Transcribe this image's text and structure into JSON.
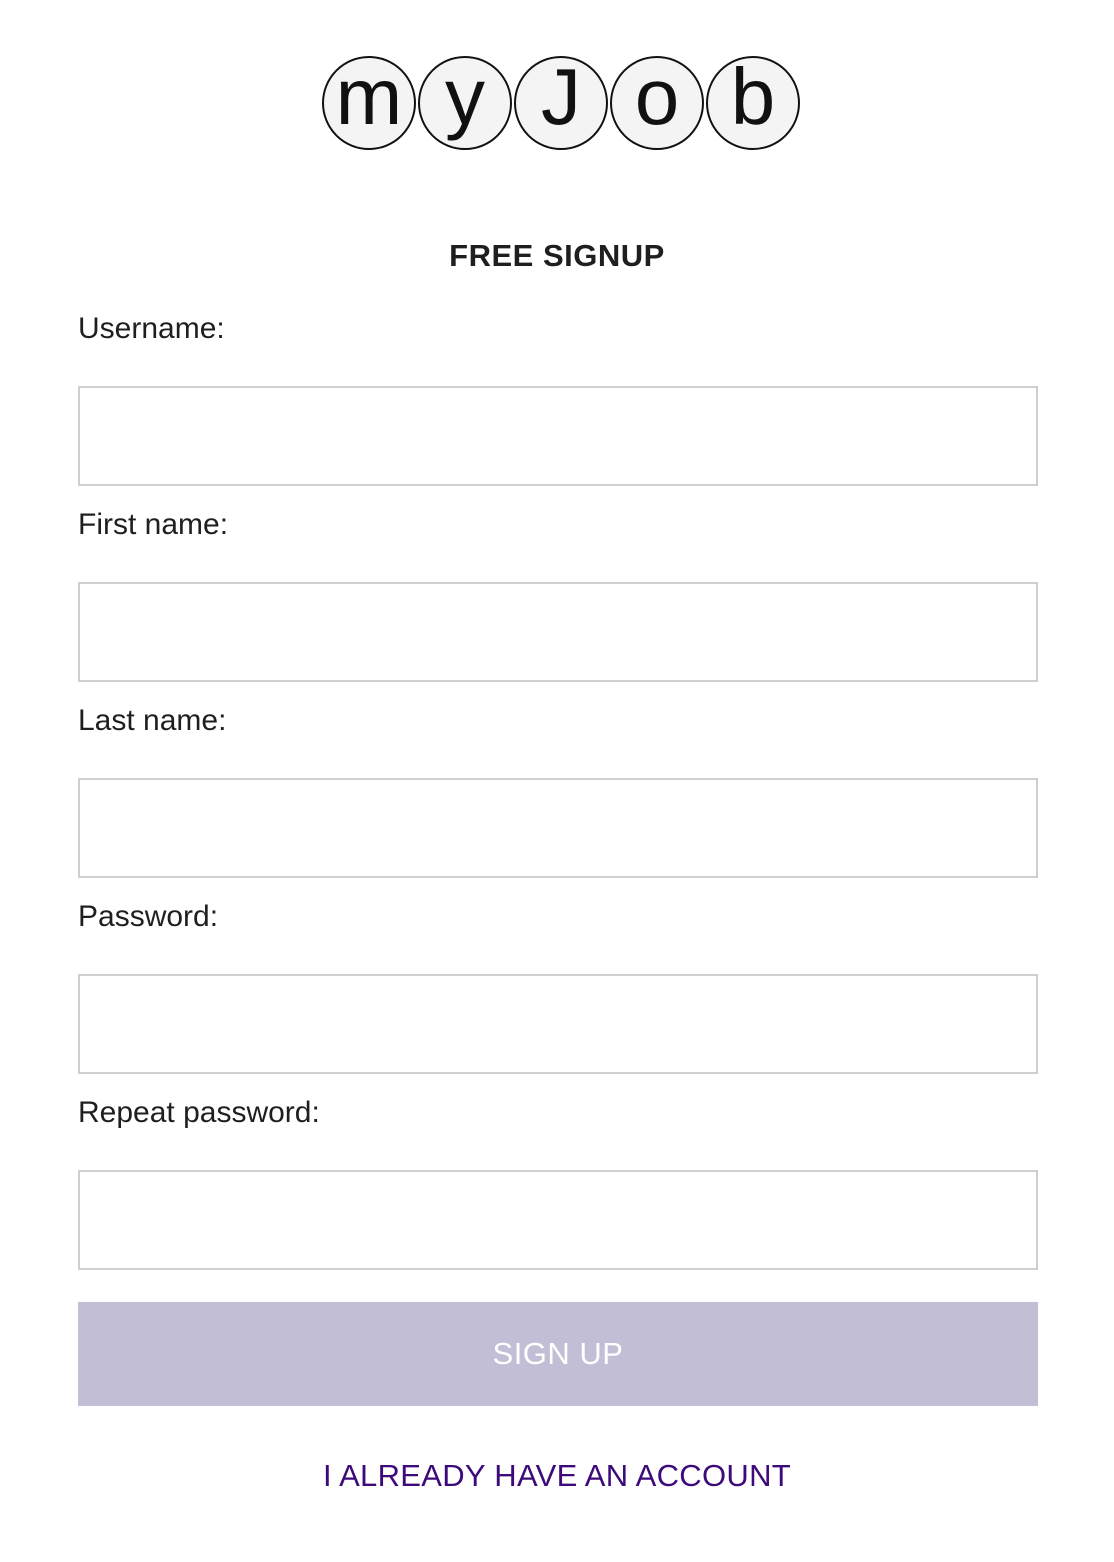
{
  "logo": {
    "letters": [
      "m",
      "y",
      "J",
      "o",
      "b"
    ]
  },
  "title": "FREE SIGNUP",
  "fields": [
    {
      "label": "Username:",
      "value": "",
      "placeholder": ""
    },
    {
      "label": "First name:",
      "value": "",
      "placeholder": ""
    },
    {
      "label": "Last name:",
      "value": "",
      "placeholder": ""
    },
    {
      "label": "Password:",
      "value": "",
      "placeholder": ""
    },
    {
      "label": "Repeat password:",
      "value": "",
      "placeholder": ""
    }
  ],
  "signup_button_label": "SIGN UP",
  "account_link_label": "I ALREADY HAVE AN ACCOUNT",
  "colors": {
    "button_bg": "#c1bed5",
    "button_text": "#ffffff",
    "link": "#3d0a7a",
    "input_border": "#cfcfcf"
  }
}
